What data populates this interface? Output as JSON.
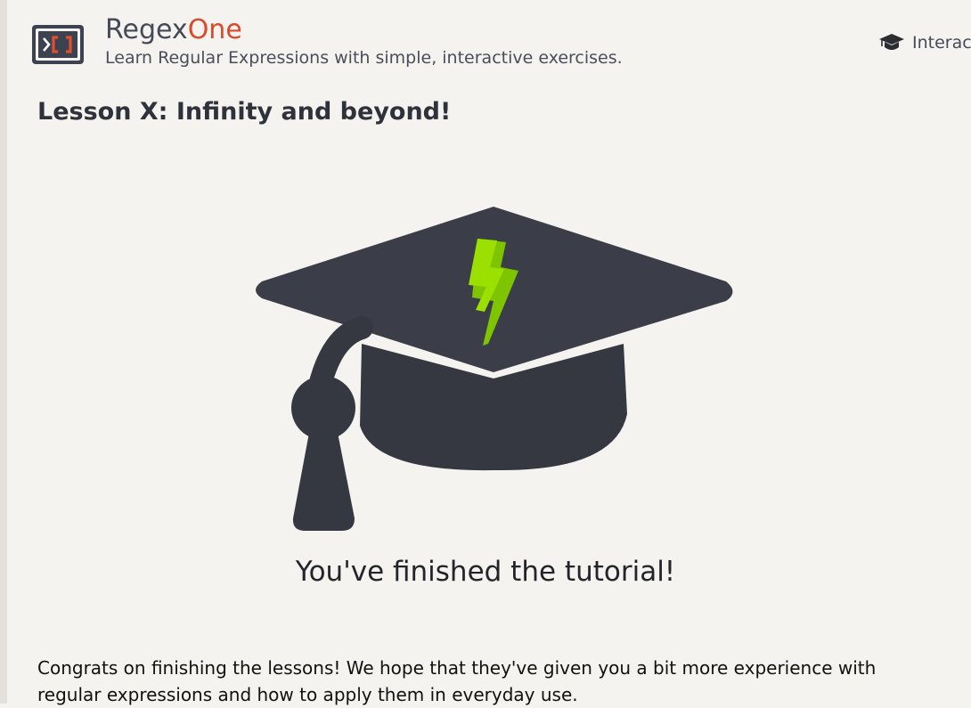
{
  "header": {
    "brand_prefix": "Regex",
    "brand_suffix": "One",
    "tagline": "Learn Regular Expressions with simple, interactive exercises.",
    "nav_link_label": "Interac"
  },
  "lesson": {
    "title": "Lesson X: Infinity and beyond!",
    "finished_message": "You've finished the tutorial!",
    "body": "Congrats on finishing the lessons! We hope that they've given you a bit more experience with regular expressions and how to apply them in everyday use."
  },
  "icons": {
    "logo": "regexone-logo-icon",
    "nav": "graduation-cap-icon",
    "hero": "graduation-cap-lightning-icon"
  },
  "colors": {
    "brand_accent": "#d9492c",
    "logo_bg": "#3d4250",
    "cap_dark": "#3b3e48",
    "bolt_green": "#8fd400",
    "background": "#f5f3ef"
  }
}
